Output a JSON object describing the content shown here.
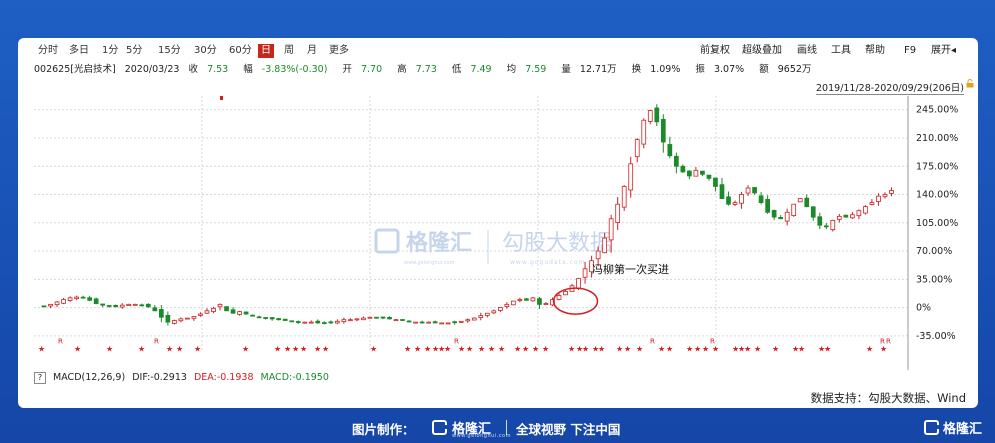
{
  "toolbar": {
    "periods": [
      "分时",
      "多日",
      "1分",
      "5分",
      "15分",
      "30分",
      "60分",
      "日",
      "周",
      "月",
      "更多"
    ],
    "active_period": "日",
    "tools": [
      "前复权",
      "超级叠加",
      "画线",
      "工具",
      "帮助",
      "F9",
      "展开"
    ]
  },
  "quote": {
    "code": "002625[光启技术]",
    "date": "2020/03/23",
    "close_label": "收",
    "close": "7.53",
    "change_label": "幅",
    "change": "-3.83%(-0.30)",
    "open_label": "开",
    "open": "7.70",
    "high_label": "高",
    "high": "7.73",
    "low_label": "低",
    "low": "7.49",
    "avg_label": "均",
    "avg": "7.59",
    "volume_label": "量",
    "volume": "12.71万",
    "turnover_label": "换",
    "turnover": "1.09%",
    "amplitude_label": "振",
    "amplitude": "3.07%",
    "amount_label": "额",
    "amount": "9652万"
  },
  "range_label": "2019/11/28-2020/09/29(206日)",
  "watermark": {
    "brand": "格隆汇",
    "brand_sub": "www.gelonghui.com",
    "brand2": "勾股大数据",
    "brand2_sub": "www.gogudata.com"
  },
  "annotation": "冯柳第一次买进",
  "signal_r": "R",
  "signal_star": "★",
  "indicator": {
    "toggle": "?",
    "name": "MACD(12,26,9)",
    "dif": "DIF:-0.2913",
    "dea": "DEA:-0.1938",
    "macd": "MACD:-0.1950"
  },
  "support": "数据支持：勾股大数据、Wind",
  "footer": {
    "made_by": "图片制作：",
    "brand": "格隆汇",
    "brand_sub": "www.gelonghui.com",
    "slogan": "全球视野 下注中国",
    "brand_right": "格隆汇"
  },
  "colors": {
    "up": "#d02020",
    "down": "#1a8a2a",
    "background": "#1e5fc4",
    "annotation_circle": "#d02020"
  },
  "chart_data": {
    "type": "candlestick",
    "y_axis_unit": "%",
    "y_ticks": [
      "245.00%",
      "210.00%",
      "175.00%",
      "140.00%",
      "105.00%",
      "70.00%",
      "35.00%",
      "0%",
      "-35.00%"
    ],
    "y_tick_values": [
      245,
      210,
      175,
      140,
      105,
      70,
      35,
      0,
      -35
    ],
    "ylim": [
      -55,
      262
    ],
    "grid": true,
    "close_path": [
      2,
      4,
      7,
      10,
      12,
      13,
      12,
      9,
      5,
      3,
      2,
      1,
      3,
      4,
      4,
      3,
      1,
      -4,
      -12,
      -18,
      -16,
      -14,
      -13,
      -11,
      -8,
      -4,
      -1,
      4,
      -4,
      -7,
      -5,
      -8,
      -10,
      -12,
      -13,
      -14,
      -15,
      -16,
      -17,
      -18,
      -18,
      -18,
      -19,
      -19,
      -18,
      -17,
      -15,
      -15,
      -14,
      -13,
      -12,
      -12,
      -13,
      -14,
      -15,
      -16,
      -17,
      -18,
      -18,
      -18,
      -19,
      -19,
      -19,
      -18,
      -17,
      -15,
      -13,
      -10,
      -7,
      -4,
      0,
      4,
      8,
      10,
      9,
      12,
      4,
      5,
      10,
      15,
      20,
      27,
      36,
      48,
      58,
      70,
      86,
      110,
      128,
      150,
      178,
      208,
      232,
      244,
      230,
      205,
      188,
      175,
      168,
      163,
      170,
      165,
      160,
      150,
      135,
      128,
      130,
      140,
      148,
      142,
      130,
      118,
      112,
      110,
      118,
      128,
      135,
      125,
      112,
      102,
      100,
      108,
      113,
      112,
      115,
      120,
      125,
      130,
      138,
      140,
      145
    ]
  }
}
